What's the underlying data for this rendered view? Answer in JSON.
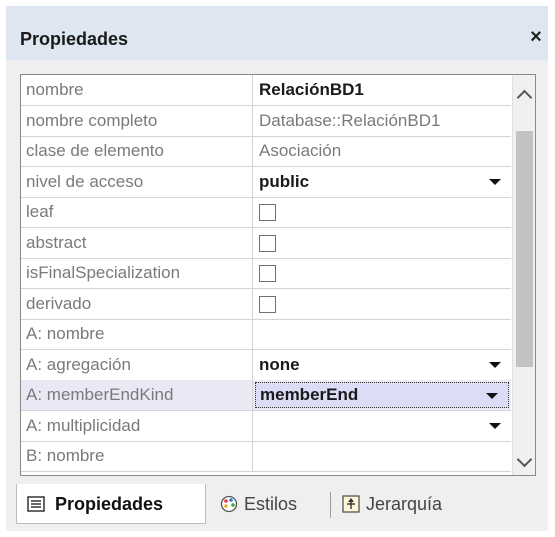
{
  "panel": {
    "title": "Propiedades",
    "close_glyph": "×"
  },
  "properties": [
    {
      "name": "nombre",
      "value": "RelaciónBD1",
      "kind": "text-bold"
    },
    {
      "name": "nombre completo",
      "value": "Database::RelaciónBD1",
      "kind": "text-gray"
    },
    {
      "name": "clase de elemento",
      "value": "Asociación",
      "kind": "text-gray"
    },
    {
      "name": "nivel de acceso",
      "value": "public",
      "kind": "dropdown"
    },
    {
      "name": "leaf",
      "value": "",
      "kind": "checkbox",
      "checked": false
    },
    {
      "name": "abstract",
      "value": "",
      "kind": "checkbox",
      "checked": false
    },
    {
      "name": "isFinalSpecialization",
      "value": "",
      "kind": "checkbox",
      "checked": false
    },
    {
      "name": "derivado",
      "value": "",
      "kind": "checkbox",
      "checked": false
    },
    {
      "name": "A: nombre",
      "value": "",
      "kind": "text-bold"
    },
    {
      "name": "A: agregación",
      "value": "none",
      "kind": "dropdown"
    },
    {
      "name": "A: memberEndKind",
      "value": "memberEnd",
      "kind": "dropdown-selected"
    },
    {
      "name": "A: multiplicidad",
      "value": "",
      "kind": "dropdown"
    },
    {
      "name": "B: nombre",
      "value": "",
      "kind": "text-bold"
    }
  ],
  "tabs": {
    "properties_label": "Propiedades",
    "properties_icon": "list-icon",
    "styles_label": "Estilos",
    "styles_icon": "palette-icon",
    "hierarchy_label": "Jerarquía",
    "hierarchy_icon": "hierarchy-icon"
  }
}
